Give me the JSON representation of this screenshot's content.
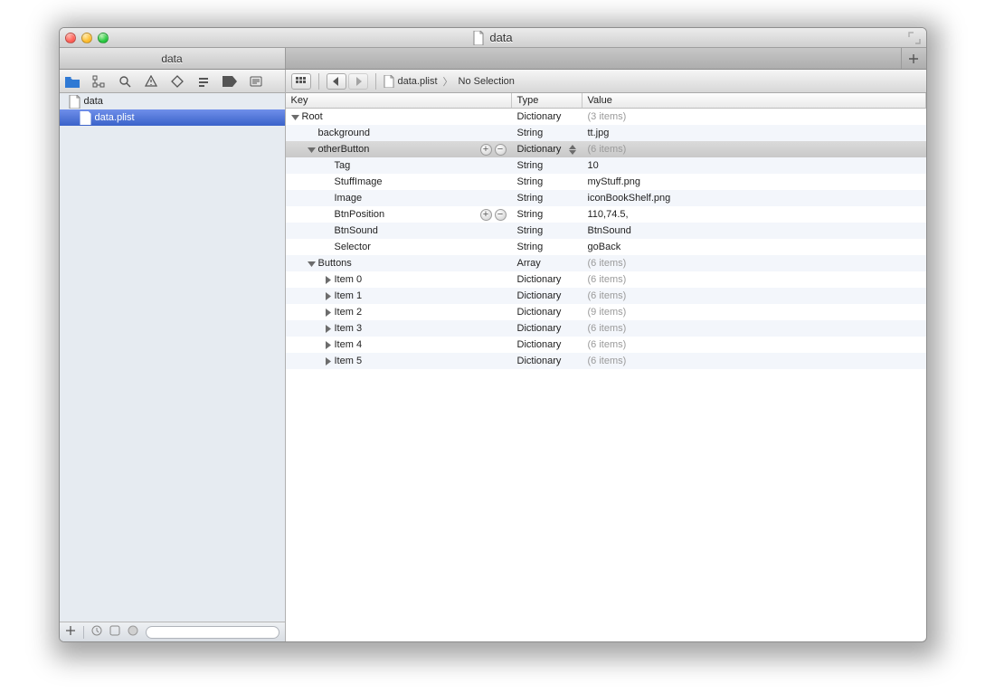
{
  "window": {
    "title": "data"
  },
  "tabbar": {
    "tab_label": "data"
  },
  "navigator": {
    "items": [
      {
        "name": "data",
        "indent": 0,
        "selected": false,
        "disclosure": "none"
      },
      {
        "name": "data.plist",
        "indent": 1,
        "selected": true,
        "disclosure": "none"
      }
    ]
  },
  "pathbar": {
    "file": "data.plist",
    "selection": "No Selection"
  },
  "columns": {
    "key": "Key",
    "type": "Type",
    "value": "Value"
  },
  "rows": [
    {
      "key": "Root",
      "type": "Dictionary",
      "value": "(3 items)",
      "muted": true,
      "indent": 0,
      "tri": "down",
      "sel": false,
      "add": false,
      "step": false
    },
    {
      "key": "background",
      "type": "String",
      "value": "tt.jpg",
      "muted": false,
      "indent": 1,
      "tri": "",
      "sel": false,
      "add": false,
      "step": false
    },
    {
      "key": "otherButton",
      "type": "Dictionary",
      "value": "(6 items)",
      "muted": true,
      "indent": 1,
      "tri": "down",
      "sel": true,
      "add": true,
      "step": true
    },
    {
      "key": "Tag",
      "type": "String",
      "value": "10",
      "muted": false,
      "indent": 2,
      "tri": "",
      "sel": false,
      "add": false,
      "step": false
    },
    {
      "key": "StuffImage",
      "type": "String",
      "value": "myStuff.png",
      "muted": false,
      "indent": 2,
      "tri": "",
      "sel": false,
      "add": false,
      "step": false
    },
    {
      "key": "Image",
      "type": "String",
      "value": "iconBookShelf.png",
      "muted": false,
      "indent": 2,
      "tri": "",
      "sel": false,
      "add": false,
      "step": false
    },
    {
      "key": "BtnPosition",
      "type": "String",
      "value": "110,74.5,",
      "muted": false,
      "indent": 2,
      "tri": "",
      "sel": false,
      "add": true,
      "step": false
    },
    {
      "key": "BtnSound",
      "type": "String",
      "value": "BtnSound",
      "muted": false,
      "indent": 2,
      "tri": "",
      "sel": false,
      "add": false,
      "step": false
    },
    {
      "key": "Selector",
      "type": "String",
      "value": "goBack",
      "muted": false,
      "indent": 2,
      "tri": "",
      "sel": false,
      "add": false,
      "step": false
    },
    {
      "key": "Buttons",
      "type": "Array",
      "value": "(6 items)",
      "muted": true,
      "indent": 1,
      "tri": "down",
      "sel": false,
      "add": false,
      "step": false
    },
    {
      "key": "Item 0",
      "type": "Dictionary",
      "value": "(6 items)",
      "muted": true,
      "indent": 2,
      "tri": "right",
      "sel": false,
      "add": false,
      "step": false
    },
    {
      "key": "Item 1",
      "type": "Dictionary",
      "value": "(6 items)",
      "muted": true,
      "indent": 2,
      "tri": "right",
      "sel": false,
      "add": false,
      "step": false
    },
    {
      "key": "Item 2",
      "type": "Dictionary",
      "value": "(9 items)",
      "muted": true,
      "indent": 2,
      "tri": "right",
      "sel": false,
      "add": false,
      "step": false
    },
    {
      "key": "Item 3",
      "type": "Dictionary",
      "value": "(6 items)",
      "muted": true,
      "indent": 2,
      "tri": "right",
      "sel": false,
      "add": false,
      "step": false
    },
    {
      "key": "Item 4",
      "type": "Dictionary",
      "value": "(6 items)",
      "muted": true,
      "indent": 2,
      "tri": "right",
      "sel": false,
      "add": false,
      "step": false
    },
    {
      "key": "Item 5",
      "type": "Dictionary",
      "value": "(6 items)",
      "muted": true,
      "indent": 2,
      "tri": "right",
      "sel": false,
      "add": false,
      "step": false
    }
  ]
}
